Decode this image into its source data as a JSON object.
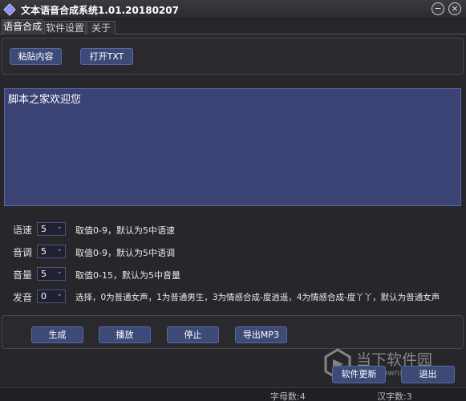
{
  "window": {
    "title": "文本语音合成系统1.01.20180207",
    "minimize": "−",
    "close": "×"
  },
  "tabs": [
    "语音合成",
    "软件设置",
    "关于"
  ],
  "toolbar": {
    "paste_label": "粘贴内容",
    "open_txt_label": "打开TXT"
  },
  "editor": {
    "text": "脚本之家欢迎您"
  },
  "settings": {
    "speed": {
      "label": "语速",
      "value": "5",
      "hint": "取值0-9，默认为5中语速"
    },
    "tone": {
      "label": "音调",
      "value": "5",
      "hint": "取值0-9，默认为5中语调"
    },
    "volume": {
      "label": "音量",
      "value": "5",
      "hint": "取值0-15，默认为5中音量"
    },
    "voice": {
      "label": "发音",
      "value": "0",
      "hint": "选择，0为普通女声，1为普通男生，3为情感合成-度逍遥，4为情感合成-度丫丫，默认为普通女声"
    }
  },
  "actions": {
    "generate": "生成",
    "play": "播放",
    "stop": "停止",
    "export": "导出MP3"
  },
  "footer": {
    "update": "软件更新",
    "exit": "退出"
  },
  "status": {
    "letters": "字母数:4",
    "hanzi": "汉字数:3"
  },
  "watermark": {
    "brand": "当下软件园",
    "url": "www.downxia.com"
  },
  "colors": {
    "accent": "#3d4a78",
    "editor_bg": "#3b4274",
    "window_bg": "#27272b"
  }
}
